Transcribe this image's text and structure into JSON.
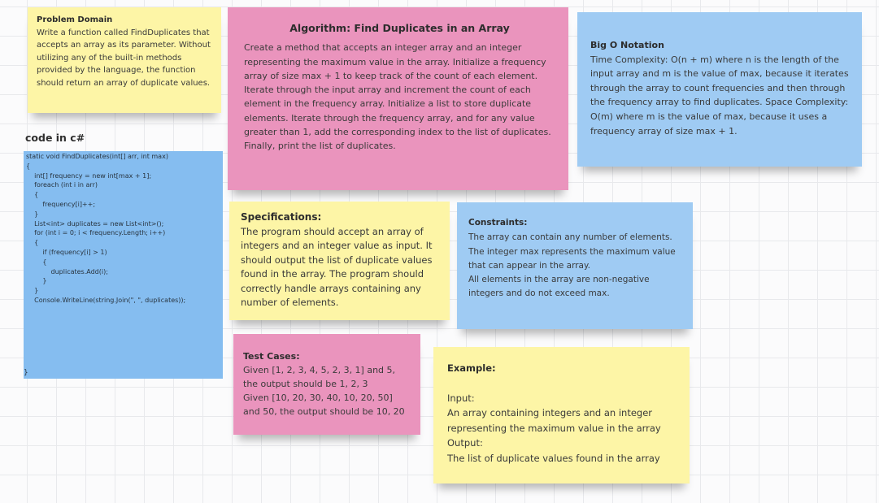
{
  "notes": {
    "problem": {
      "title": "Problem Domain",
      "body": "Write a function called FindDuplicates that accepts an array as its parameter. Without utilizing any of the built-in methods provided by the language, the function should return an array of duplicate values."
    },
    "algorithm": {
      "title": "Algorithm: Find Duplicates in an Array",
      "body": "Create a method that accepts an integer array and an integer representing the maximum value in the array. Initialize a frequency array of size max + 1 to keep track of the count of each element. Iterate through the input array and increment the count of each element in the frequency array. Initialize a list to store duplicate elements. Iterate through the frequency array, and for any value greater than 1, add the corresponding index to the list of duplicates. Finally, print the list of duplicates."
    },
    "bigo": {
      "title": "Big O Notation",
      "body": "Time Complexity: O(n + m) where n is the length of the input array and m is the value of max, because it iterates through the array to count frequencies and then through the frequency array to find duplicates. Space Complexity: O(m) where m is the value of max, because it uses a frequency array of size max + 1."
    },
    "specifications": {
      "title": "Specifications:",
      "body": "The program should accept an array of integers and an integer value as input. It should output the list of duplicate values found in the array. The program should correctly handle arrays containing any number of elements."
    },
    "constraints": {
      "title": "Constraints:",
      "lines": [
        "The array can contain any number of elements.",
        "The integer max represents the maximum value that can appear in the array.",
        "All elements in the array are non-negative integers and do not exceed max."
      ]
    },
    "testcases": {
      "title": "Test Cases:",
      "lines": [
        "Given [1, 2, 3, 4, 5, 2, 3, 1] and 5, the output should be 1, 2, 3",
        "Given [10, 20, 30, 40, 10, 20, 50] and 50, the output should be 10, 20"
      ]
    },
    "example": {
      "title": "Example:",
      "input_label": "Input:",
      "input_text": "An array containing integers and an integer representing the maximum value in the array",
      "output_label": "Output:",
      "output_text": "The list of duplicate values found in the array"
    }
  },
  "code": {
    "label": "code in c#",
    "lines": [
      "static void FindDuplicates(int[] arr, int max)",
      "{",
      "    int[] frequency = new int[max + 1];",
      "",
      "    foreach (int i in arr)",
      "    {",
      "        frequency[i]++;",
      "",
      "",
      "    }",
      "    List<int> duplicates = new List<int>();",
      "    for (int i = 0; i < frequency.Length; i++)",
      "    {",
      "        if (frequency[i] > 1)",
      "        {",
      "            duplicates.Add(i);",
      "        }",
      "    }",
      "    Console.WriteLine(string.Join(\", \", duplicates));"
    ],
    "closing": "}"
  }
}
